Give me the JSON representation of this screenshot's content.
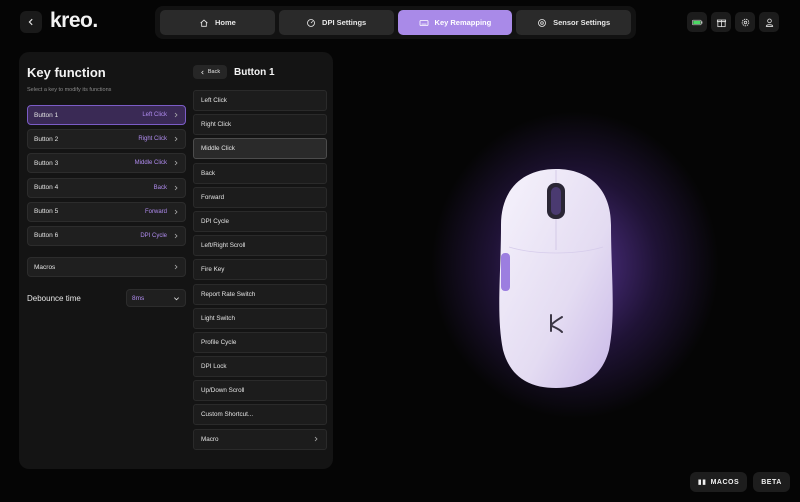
{
  "app": {
    "brand": "kreo."
  },
  "tabs": [
    {
      "label": "Home",
      "icon": "home-icon"
    },
    {
      "label": "DPI Settings",
      "icon": "gauge-icon"
    },
    {
      "label": "Key Remapping",
      "icon": "keyboard-icon"
    },
    {
      "label": "Sensor Settings",
      "icon": "sensor-icon"
    }
  ],
  "active_tab": "Key Remapping",
  "top_icons": [
    "battery-icon",
    "gift-icon",
    "gear-icon",
    "user-icon"
  ],
  "left": {
    "title": "Key function",
    "subtitle": "Select a key to modify its functions",
    "buttons": [
      {
        "name": "Button 1",
        "value": "Left Click"
      },
      {
        "name": "Button 2",
        "value": "Right Click"
      },
      {
        "name": "Button 3",
        "value": "Middle Click"
      },
      {
        "name": "Button 4",
        "value": "Back"
      },
      {
        "name": "Button 5",
        "value": "Forward"
      },
      {
        "name": "Button 6",
        "value": "DPI Cycle"
      }
    ],
    "macros_label": "Macros",
    "debounce_label": "Debounce time",
    "debounce_value": "8ms"
  },
  "right": {
    "back_label": "Back",
    "title": "Button 1",
    "functions": [
      "Left Click",
      "Right Click",
      "Middle Click",
      "Back",
      "Forward",
      "DPI Cycle",
      "Left/Right Scroll",
      "Fire Key",
      "Report Rate Switch",
      "Light Switch",
      "Profile Cycle",
      "DPI Lock",
      "Up/Down Scroll",
      "Custom Shortcut...",
      "Macro"
    ]
  },
  "footer": {
    "os_label": "MACOS",
    "beta_label": "BETA"
  },
  "colors": {
    "accent": "#a98ae8",
    "accent_text": "#b08cf0",
    "panel": "#141414",
    "background": "#050505"
  }
}
